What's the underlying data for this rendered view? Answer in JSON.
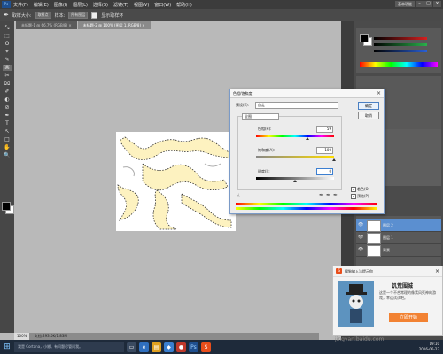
{
  "menubar": {
    "logo": "Ps",
    "items": [
      "文件(F)",
      "编辑(E)",
      "图像(I)",
      "图层(L)",
      "选择(S)",
      "滤镜(T)",
      "视图(V)",
      "窗口(W)",
      "帮助(H)"
    ],
    "workspace": "基本功能",
    "window_controls": [
      "–",
      "□",
      "×"
    ]
  },
  "options_bar": {
    "sample_size_label": "取样大小:",
    "sample_size_value": "取样点",
    "sample_label": "样本:",
    "sample_value": "所有图层",
    "show_ring_label": "显示取样环"
  },
  "doc_tabs": [
    "未标题-1 @ 66.7% (RGB/8) ×",
    "未标题-2 @ 100% (图层 1, RGB/8) ×"
  ],
  "toolbar": {
    "tools": [
      "⤡",
      "⬚",
      "ʘ",
      "⌖",
      "✎",
      "⌘",
      "✂",
      "⌧",
      "✐",
      "◐",
      "⊘",
      "✒",
      "T",
      "↖",
      "□",
      "✋",
      "🔍"
    ],
    "foreground": "#000000",
    "background": "#ffffff"
  },
  "color_panel": {
    "slider_colors": [
      "#d62020",
      "#2ab04a",
      "#2a60d6"
    ],
    "palette": [
      "#ff0000",
      "#ffff00",
      "#00ff00",
      "#00ffff",
      "#0000ff",
      "#ff00ff"
    ]
  },
  "layers_panel": {
    "layers": [
      {
        "name": "图层 2",
        "selected": true
      },
      {
        "name": "图层 1",
        "selected": false
      },
      {
        "name": "背景",
        "selected": false
      }
    ]
  },
  "dialog": {
    "title": "色相/饱和度",
    "preset_label": "预设(E):",
    "preset_value": "自定",
    "channel_value": "全图",
    "hue_label": "色相(H):",
    "hue_value": 59,
    "saturation_label": "饱和度(A):",
    "saturation_value": 100,
    "lightness_label": "明度(I):",
    "lightness_value": 0,
    "ok_label": "确定",
    "cancel_label": "取消",
    "colorize_label": "着色(O)",
    "preview_label": "预览(P)",
    "colorize_checked": true,
    "preview_checked": true
  },
  "status": {
    "zoom": "100%",
    "doc_info": "文档:293.0K/1.83M"
  },
  "ime_popup": {
    "title": "搜狗输入法提示你",
    "heading": "饥荒围城",
    "body": "这是一个不合常理的像素风死神的游戏，幸运试试吧。",
    "button": "立即开始"
  },
  "taskbar": {
    "search_placeholder": "我是 Cortana，小娜。有问题尽管问我。",
    "time": "19:10",
    "date": "2016-06-23"
  },
  "watermark": "jingyan.baidu.com"
}
